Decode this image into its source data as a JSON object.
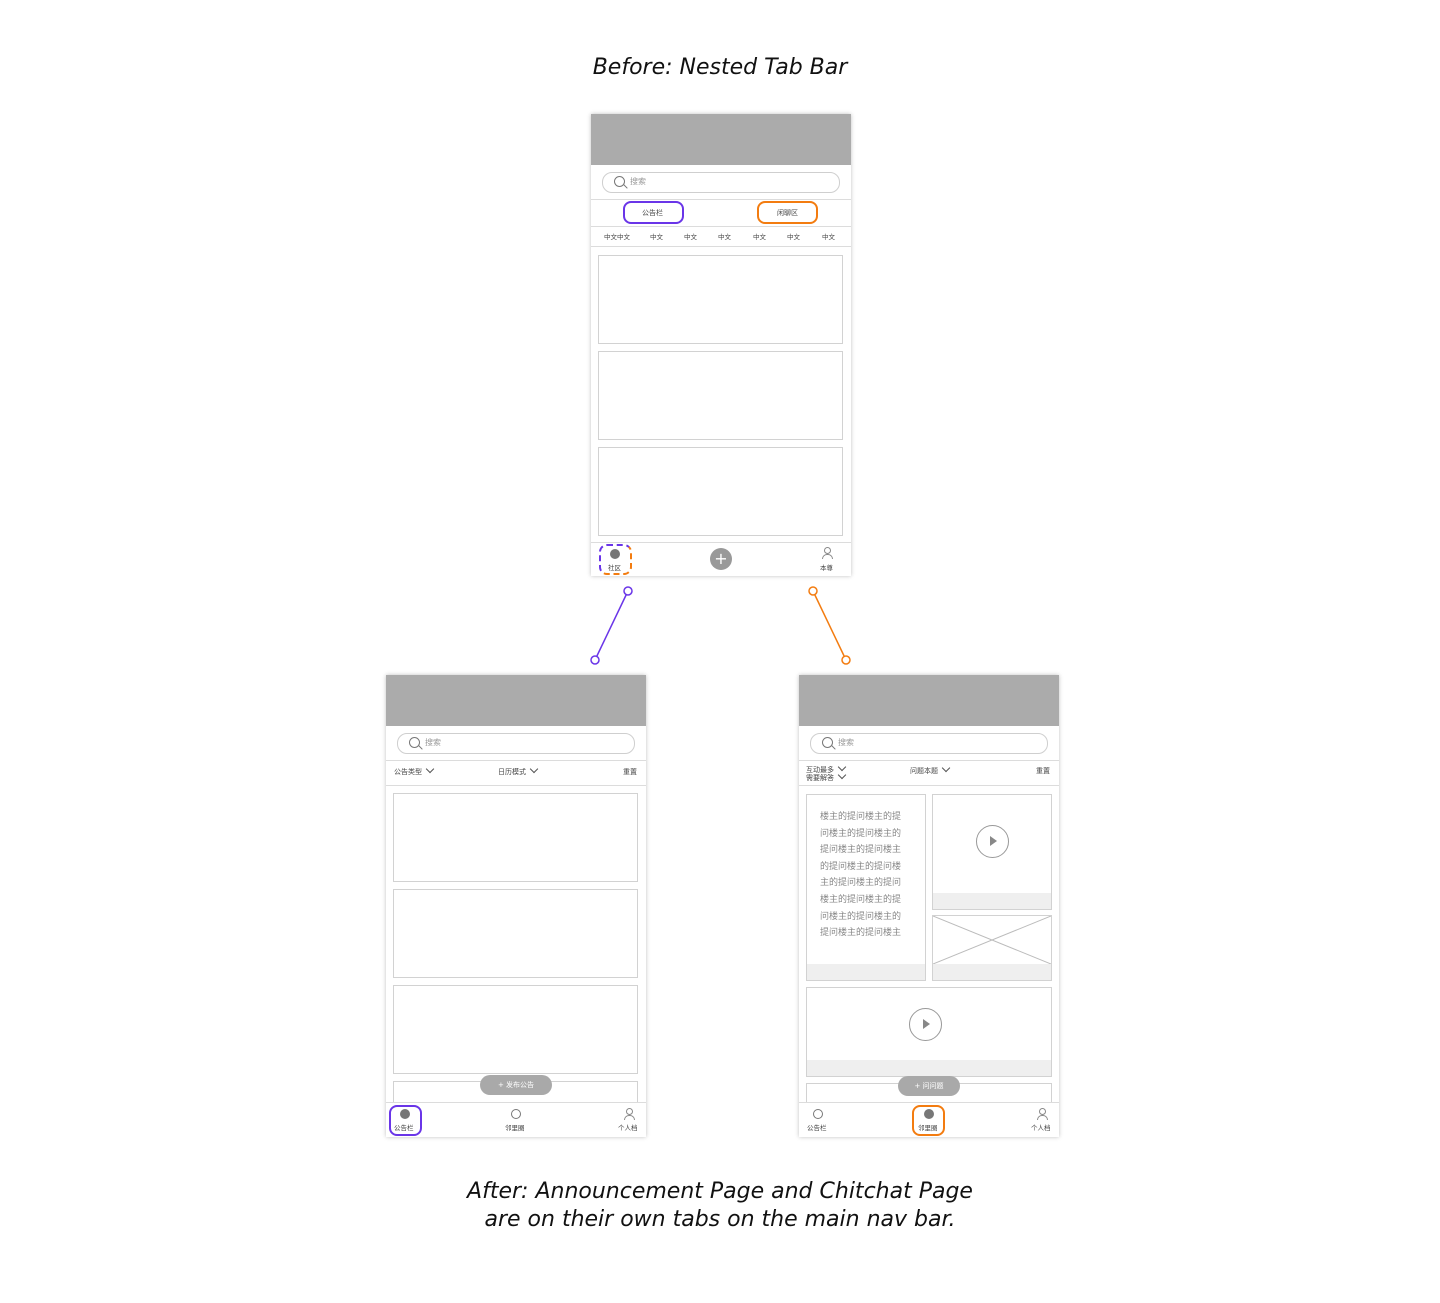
{
  "captions": {
    "before": "Before: Nested Tab Bar",
    "after_line1": "After: Announcement Page and Chitchat Page",
    "after_line2": "are on their own tabs on the main nav bar."
  },
  "colors": {
    "accent_announcement": "#6a35e8",
    "accent_chitchat": "#f37c10",
    "header_gray": "#ababab"
  },
  "before": {
    "search_placeholder": "搜索",
    "tab_left": "公告栏",
    "tab_right": "闲聊区",
    "subtabs": [
      "中文中文",
      "中文",
      "中文",
      "中文",
      "中文",
      "中文",
      "中文"
    ],
    "nav_left": "社区",
    "nav_center_icon": "plus-icon",
    "nav_right": "本尊"
  },
  "after_left": {
    "search_placeholder": "搜索",
    "filter_1": "公告类型",
    "filter_2": "日历模式",
    "filter_reset": "重置",
    "fab": "+ 发布公告",
    "nav": [
      "公告栏",
      "邻里圈",
      "个人档"
    ]
  },
  "after_right": {
    "search_placeholder": "搜索",
    "filter_1_line1": "互动最多",
    "filter_1_line2": "需要解答",
    "filter_2": "问题本题",
    "filter_reset": "重置",
    "text_card_lines": [
      "楼主的提问楼主的提",
      "问楼主的提问楼主的",
      "提问楼主的提问楼主",
      "的提问楼主的提问楼",
      "主的提问楼主的提问",
      "楼主的提问楼主的提",
      "问楼主的提问楼主的",
      "提问楼主的提问楼主"
    ],
    "fab": "+ 问问题",
    "nav": [
      "公告栏",
      "邻里圈",
      "个人档"
    ]
  }
}
